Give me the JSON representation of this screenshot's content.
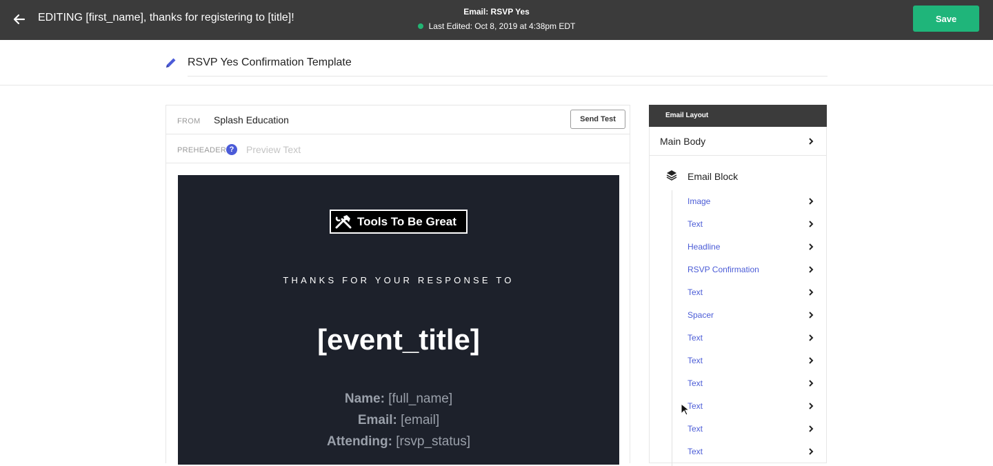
{
  "header": {
    "title": "EDITING [first_name], thanks for registering to [title]!",
    "email_name": "Email: RSVP Yes",
    "last_edited": "Last Edited: Oct 8, 2019 at 4:38pm EDT",
    "save_label": "Save",
    "status_color": "#22b573"
  },
  "template": {
    "name": "RSVP Yes Confirmation Template"
  },
  "editor": {
    "from_label": "FROM",
    "from_value": "Splash Education",
    "send_test_label": "Send Test",
    "preheader_label": "PREHEADER",
    "help_glyph": "?",
    "preview_placeholder": "Preview Text"
  },
  "email": {
    "logo_text": "Tools To Be Great",
    "tagline": "THANKS FOR YOUR RESPONSE TO",
    "event_title": "[event_title]",
    "name_label": "Name:",
    "name_value": "[full_name]",
    "email_label": "Email:",
    "email_value": "[email]",
    "attending_label": "Attending:",
    "attending_value": "[rsvp_status]",
    "background": "#1d212b"
  },
  "layout": {
    "header": "Email Layout",
    "main_body": "Main Body",
    "block": "Email Block",
    "items": [
      {
        "label": "Image"
      },
      {
        "label": "Text"
      },
      {
        "label": "Headline"
      },
      {
        "label": "RSVP Confirmation"
      },
      {
        "label": "Text"
      },
      {
        "label": "Spacer"
      },
      {
        "label": "Text"
      },
      {
        "label": "Text"
      },
      {
        "label": "Text"
      },
      {
        "label": "Text"
      },
      {
        "label": "Text"
      },
      {
        "label": "Text"
      }
    ],
    "accent": "#4a5bd6"
  }
}
